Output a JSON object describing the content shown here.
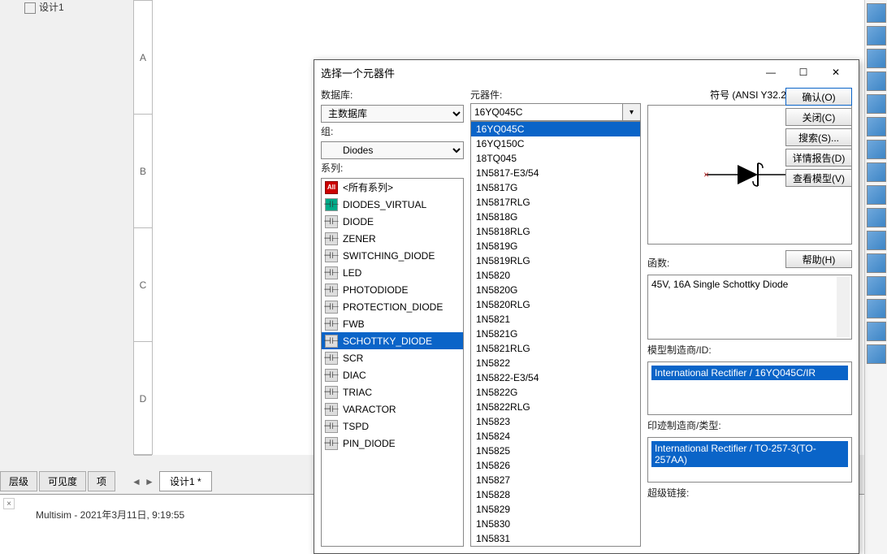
{
  "tree": {
    "design_label": "设计1"
  },
  "ruler": [
    "A",
    "B",
    "C",
    "D"
  ],
  "bottom_tabs": [
    "层级",
    "可见度",
    "项"
  ],
  "doc_tab": "设计1 *",
  "status": "Multisim  -  2021年3月11日, 9:19:55",
  "dialog": {
    "title": "选择一个元器件",
    "database_label": "数据库:",
    "database_value": "主数据库",
    "group_label": "组:",
    "group_value": "Diodes",
    "series_label": "系列:",
    "series": [
      {
        "icon": "all",
        "label": "<所有系列>"
      },
      {
        "icon": "virt",
        "label": "DIODES_VIRTUAL"
      },
      {
        "icon": "d",
        "label": "DIODE"
      },
      {
        "icon": "d",
        "label": "ZENER"
      },
      {
        "icon": "d",
        "label": "SWITCHING_DIODE"
      },
      {
        "icon": "d",
        "label": "LED"
      },
      {
        "icon": "d",
        "label": "PHOTODIODE"
      },
      {
        "icon": "d",
        "label": "PROTECTION_DIODE"
      },
      {
        "icon": "d",
        "label": "FWB"
      },
      {
        "icon": "d",
        "label": "SCHOTTKY_DIODE",
        "selected": true
      },
      {
        "icon": "d",
        "label": "SCR"
      },
      {
        "icon": "d",
        "label": "DIAC"
      },
      {
        "icon": "d",
        "label": "TRIAC"
      },
      {
        "icon": "d",
        "label": "VARACTOR"
      },
      {
        "icon": "d",
        "label": "TSPD"
      },
      {
        "icon": "d",
        "label": "PIN_DIODE"
      }
    ],
    "component_label": "元器件:",
    "component_value": "16YQ045C",
    "components": [
      "16YQ045C",
      "16YQ150C",
      "18TQ045",
      "1N5817-E3/54",
      "1N5817G",
      "1N5817RLG",
      "1N5818G",
      "1N5818RLG",
      "1N5819G",
      "1N5819RLG",
      "1N5820",
      "1N5820G",
      "1N5820RLG",
      "1N5821",
      "1N5821G",
      "1N5821RLG",
      "1N5822",
      "1N5822-E3/54",
      "1N5822G",
      "1N5822RLG",
      "1N5823",
      "1N5824",
      "1N5825",
      "1N5826",
      "1N5827",
      "1N5828",
      "1N5829",
      "1N5830",
      "1N5831"
    ],
    "component_selected": "16YQ045C",
    "symbol_label": "符号 (ANSI Y32.2)",
    "buttons": {
      "ok": "确认(O)",
      "close": "关闭(C)",
      "search": "搜索(S)...",
      "report": "详情报告(D)",
      "model": "查看模型(V)",
      "help": "帮助(H)"
    },
    "function_label": "函数:",
    "function_value": "45V, 16A Single Schottky Diode",
    "model_mfg_label": "模型制造商/ID:",
    "model_mfg_value": "International Rectifier / 16YQ045C/IR",
    "footprint_label": "印迹制造商/类型:",
    "footprint_value": "International Rectifier / TO-257-3(TO-257AA)",
    "hyperlink_label": "超级链接:"
  }
}
